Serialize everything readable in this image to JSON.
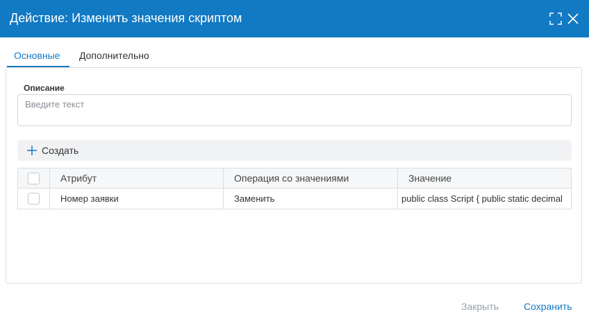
{
  "dialog": {
    "title": "Действие: Изменить значения скриптом"
  },
  "tabs": [
    {
      "label": "Основные",
      "active": true
    },
    {
      "label": "Дополнительно",
      "active": false
    }
  ],
  "description": {
    "label": "Описание",
    "placeholder": "Введите текст",
    "value": ""
  },
  "toolbar": {
    "create_label": "Создать",
    "create_icon": "plus-icon"
  },
  "table": {
    "columns": [
      "Атрибут",
      "Операция со значениями",
      "Значение"
    ],
    "rows": [
      {
        "attribute": "Номер заявки",
        "operation": "Заменить",
        "value": "public class Script { public static decimal"
      }
    ]
  },
  "footer": {
    "close_label": "Закрыть",
    "save_label": "Сохранить"
  },
  "colors": {
    "accent": "#1279c3",
    "disabled_text": "#9aa0a6"
  }
}
